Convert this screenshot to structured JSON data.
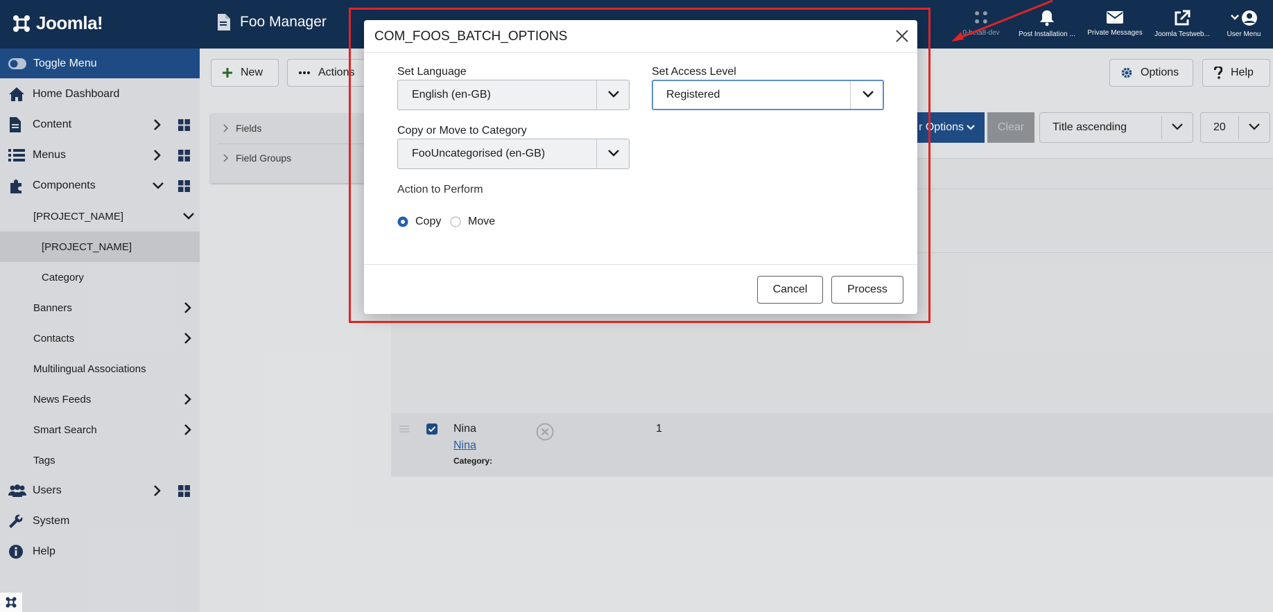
{
  "header": {
    "logo_text": "Joomla!",
    "page_title": "Foo Manager",
    "items": [
      {
        "label": "0-beta8-dev"
      },
      {
        "label": "Post Installation ..."
      },
      {
        "label": "Private Messages"
      },
      {
        "label": "Joomla Testweb..."
      },
      {
        "label": "User Menu"
      }
    ]
  },
  "sidebar": {
    "toggle_label": "Toggle Menu",
    "items": [
      {
        "label": "Home Dashboard"
      },
      {
        "label": "Content"
      },
      {
        "label": "Menus"
      },
      {
        "label": "Components"
      },
      {
        "label": "[PROJECT_NAME]"
      },
      {
        "label": "[PROJECT_NAME]"
      },
      {
        "label": "Category"
      },
      {
        "label": "Banners"
      },
      {
        "label": "Contacts"
      },
      {
        "label": "Multilingual Associations"
      },
      {
        "label": "News Feeds"
      },
      {
        "label": "Smart Search"
      },
      {
        "label": "Tags"
      },
      {
        "label": "Users"
      },
      {
        "label": "System"
      },
      {
        "label": "Help"
      }
    ]
  },
  "toolbar": {
    "new_label": "New",
    "actions_label": "Actions",
    "options_label": "Options",
    "help_label": "Help"
  },
  "side_panel": {
    "items": [
      {
        "label": "Fields"
      },
      {
        "label": "Field Groups"
      }
    ]
  },
  "filters": {
    "filter_options_label": "r Options",
    "clear_label": "Clear",
    "ordering_value": "Title ascending",
    "limit_value": "20"
  },
  "table": {
    "row": {
      "title": "Nina",
      "alias_link": "Nina",
      "category_label": "Category:",
      "value": "1"
    }
  },
  "modal": {
    "title": "COM_FOOS_BATCH_OPTIONS",
    "language_label": "Set Language",
    "language_value": "English (en-GB)",
    "access_label": "Set Access Level",
    "access_value": "Registered",
    "category_label": "Copy or Move to Category",
    "category_value": "FooUncategorised (en-GB)",
    "action_label": "Action to Perform",
    "copy_label": "Copy",
    "move_label": "Move",
    "selected_action": "copy",
    "cancel_label": "Cancel",
    "process_label": "Process"
  },
  "colors": {
    "header_bg": "#132f53",
    "accent": "#1f4d87",
    "annotation": "#e02424"
  }
}
